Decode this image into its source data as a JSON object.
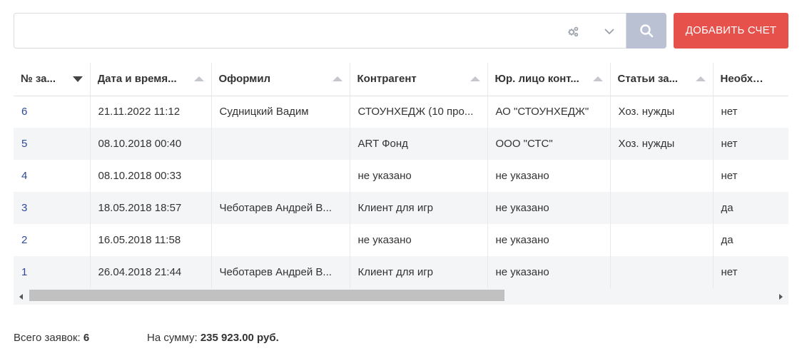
{
  "search": {
    "value": "",
    "placeholder": ""
  },
  "toolbar": {
    "add_label": "ДОБАВИТЬ СЧЕТ"
  },
  "icons": {
    "filter": "gears-icon",
    "dropdown": "chevron-down-icon",
    "search": "search-icon"
  },
  "colors": {
    "accent_red": "#e7514c",
    "search_button": "#b9c1d3",
    "link_blue": "#2d4a9a"
  },
  "table": {
    "columns": [
      {
        "label": "№ за...",
        "sort": "desc"
      },
      {
        "label": "Дата и время...",
        "sort": "asc"
      },
      {
        "label": "Оформил",
        "sort": "asc"
      },
      {
        "label": "Контрагент",
        "sort": "asc"
      },
      {
        "label": "Юр. лицо конт...",
        "sort": "asc"
      },
      {
        "label": "Статьи за...",
        "sort": "asc"
      },
      {
        "label": "Необходи...",
        "sort": "none"
      }
    ],
    "rows": [
      [
        "6",
        "21.11.2022 11:12",
        "Судницкий Вадим",
        "СТОУНХЕДЖ (10 про...",
        "АО \"СТОУНХЕДЖ\"",
        "Хоз. нужды",
        "нет"
      ],
      [
        "5",
        "08.10.2018 00:40",
        "",
        "ART Фонд",
        "ООО \"СТС\"",
        "Хоз. нужды",
        "нет"
      ],
      [
        "4",
        "08.10.2018 00:33",
        "",
        "не указано",
        "не указано",
        "",
        "нет"
      ],
      [
        "3",
        "18.05.2018 18:57",
        "Чеботарев Андрей В...",
        "Клиент для игр",
        "не указано",
        "",
        "да"
      ],
      [
        "2",
        "16.05.2018 11:58",
        "",
        "не указано",
        "не указано",
        "",
        "да"
      ],
      [
        "1",
        "26.04.2018 21:44",
        "Чеботарев Андрей В...",
        "Клиент для игр",
        "не указано",
        "",
        "нет"
      ]
    ]
  },
  "summary": {
    "total_label": "Всего заявок:",
    "total_value": "6",
    "amount_label": "На сумму:",
    "amount_value": "235 923.00 руб."
  }
}
